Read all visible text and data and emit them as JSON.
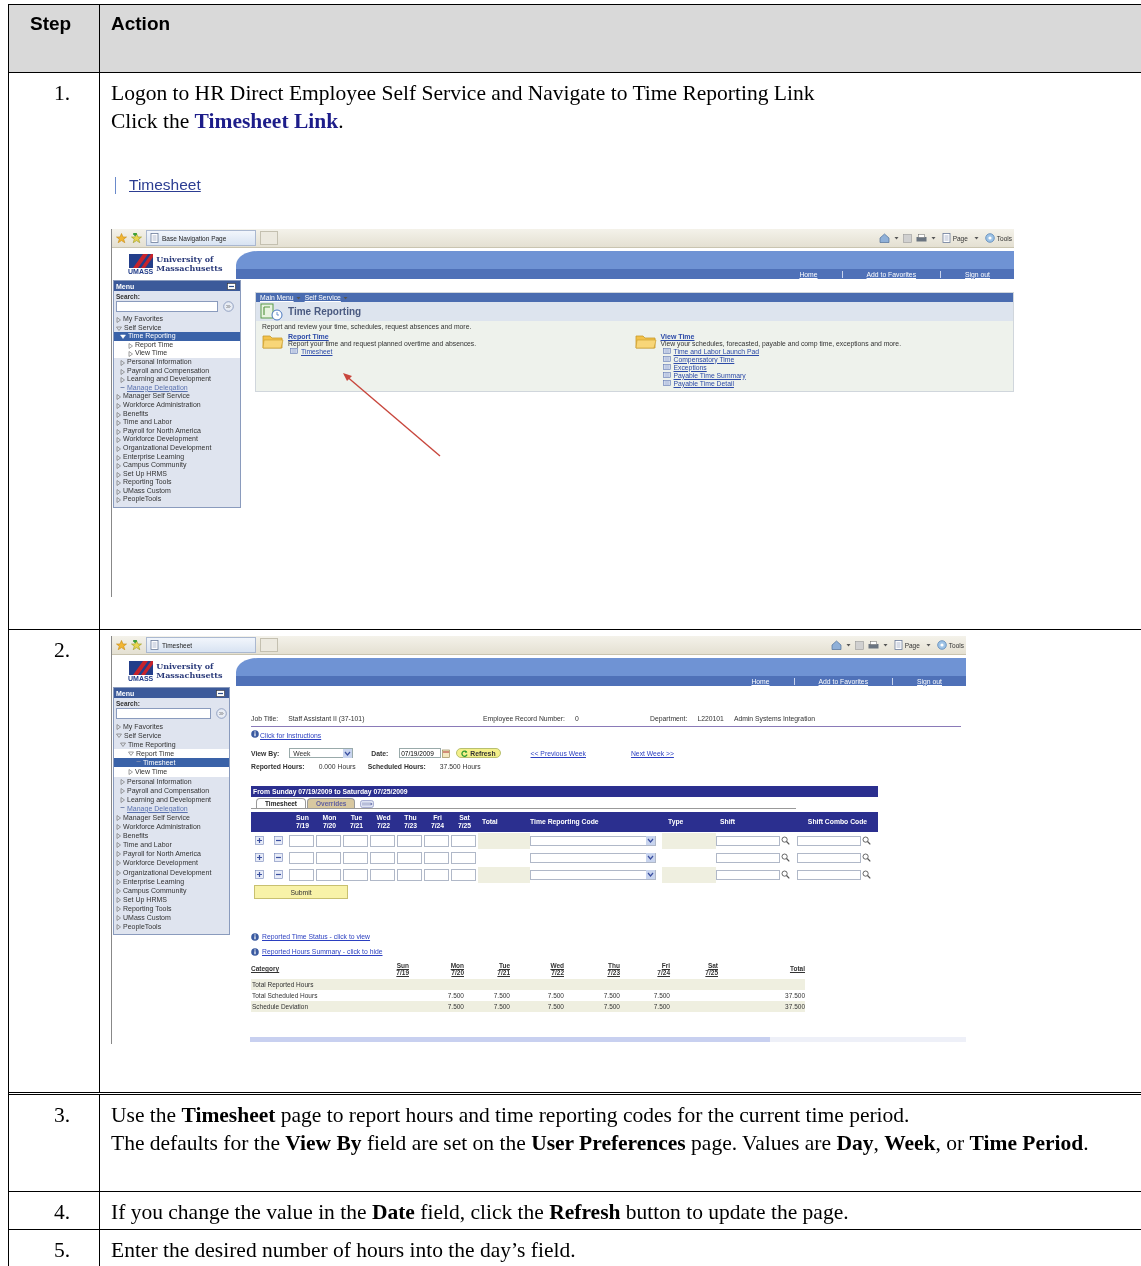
{
  "table": {
    "columns": [
      "Step",
      "Action"
    ],
    "rows": [
      {
        "step": "1.",
        "blocks": [
          {
            "kind": "instruction",
            "lines": [
              "Logon to HR Direct Employee Self Service and Navigate to Time Reporting Link",
              "Click the **Timesheet Link**."
            ]
          },
          {
            "kind": "link",
            "text": "Timesheet"
          },
          {
            "kind": "screenshot",
            "browser": {
              "tab_title": "Base Navigation Page",
              "toolbar": [
                "Page",
                "Tools"
              ]
            },
            "header": {
              "logo_mark": "UMASS",
              "logo_lines": [
                "University of",
                "Massachusetts"
              ],
              "nav": [
                "Home",
                "Add to Favorites",
                "Sign out"
              ]
            },
            "menu": {
              "title": "Menu",
              "search_label": "Search:",
              "items": [
                {
                  "label": "My Favorites",
                  "kind": "folder",
                  "expanded": false,
                  "selected": false
                },
                {
                  "label": "Self Service",
                  "kind": "folder",
                  "expanded": true,
                  "selected": false,
                  "children": [
                    {
                      "label": "Time Reporting",
                      "kind": "folder",
                      "expanded": true,
                      "selected": true,
                      "children": [
                        {
                          "label": "Report Time",
                          "kind": "folder",
                          "expanded": false,
                          "selected": false
                        },
                        {
                          "label": "View Time",
                          "kind": "folder",
                          "expanded": false,
                          "selected": false
                        }
                      ]
                    },
                    {
                      "label": "Personal Information",
                      "kind": "folder",
                      "expanded": false,
                      "selected": false
                    },
                    {
                      "label": "Payroll and Compensation",
                      "kind": "folder",
                      "expanded": false,
                      "selected": false
                    },
                    {
                      "label": "Learning and Development",
                      "kind": "folder",
                      "expanded": false,
                      "selected": false
                    },
                    {
                      "label": "Manage Delegation",
                      "kind": "link",
                      "selected": false
                    }
                  ]
                },
                {
                  "label": "Manager Self Service",
                  "kind": "folder",
                  "expanded": false,
                  "selected": false
                },
                {
                  "label": "Workforce Administration",
                  "kind": "folder",
                  "expanded": false,
                  "selected": false
                },
                {
                  "label": "Benefits",
                  "kind": "folder",
                  "expanded": false,
                  "selected": false
                },
                {
                  "label": "Time and Labor",
                  "kind": "folder",
                  "expanded": false,
                  "selected": false
                },
                {
                  "label": "Payroll for North America",
                  "kind": "folder",
                  "expanded": false,
                  "selected": false
                },
                {
                  "label": "Workforce Development",
                  "kind": "folder",
                  "expanded": false,
                  "selected": false
                },
                {
                  "label": "Organizational Development",
                  "kind": "folder",
                  "expanded": false,
                  "selected": false
                },
                {
                  "label": "Enterprise Learning",
                  "kind": "folder",
                  "expanded": false,
                  "selected": false
                },
                {
                  "label": "Campus Community",
                  "kind": "folder",
                  "expanded": false,
                  "selected": false
                },
                {
                  "label": "Set Up HRMS",
                  "kind": "folder",
                  "expanded": false,
                  "selected": false
                },
                {
                  "label": "Reporting Tools",
                  "kind": "folder",
                  "expanded": false,
                  "selected": false
                },
                {
                  "label": "UMass Custom",
                  "kind": "folder",
                  "expanded": false,
                  "selected": false
                },
                {
                  "label": "PeopleTools",
                  "kind": "folder",
                  "expanded": false,
                  "selected": false
                }
              ]
            },
            "page": {
              "kind": "navigation",
              "breadcrumb": [
                "Main Menu",
                "Self Service"
              ],
              "title": "Time Reporting",
              "description": "Report and review your time, schedules, request absences and more.",
              "sections": [
                {
                  "title": "Report Time",
                  "description": "Report your time and request planned overtime and absences.",
                  "links": [
                    "Timesheet"
                  ]
                },
                {
                  "title": "View Time",
                  "description": "View your schedules, forecasted, payable and comp time, exceptions and more.",
                  "links": [
                    "Time and Labor Launch Pad",
                    "Compensatory Time",
                    "Exceptions",
                    "Payable Time Summary",
                    "Payable Time Detail"
                  ]
                }
              ]
            }
          }
        ]
      },
      {
        "step": "2.",
        "blocks": [
          {
            "kind": "screenshot",
            "browser": {
              "tab_title": "Timesheet",
              "toolbar": [
                "Page",
                "Tools"
              ]
            },
            "header": {
              "logo_mark": "UMASS",
              "logo_lines": [
                "University of",
                "Massachusetts"
              ],
              "nav": [
                "Home",
                "Add to Favorites",
                "Sign out"
              ]
            },
            "menu": {
              "title": "Menu",
              "search_label": "Search:",
              "items": [
                {
                  "label": "My Favorites",
                  "kind": "folder",
                  "expanded": false,
                  "selected": false
                },
                {
                  "label": "Self Service",
                  "kind": "folder",
                  "expanded": true,
                  "selected": false,
                  "children": [
                    {
                      "label": "Time Reporting",
                      "kind": "folder",
                      "expanded": true,
                      "selected": false,
                      "children": [
                        {
                          "label": "Report Time",
                          "kind": "folder",
                          "expanded": true,
                          "selected": false,
                          "children": [
                            {
                              "label": "Timesheet",
                              "kind": "link",
                              "selected": true
                            }
                          ]
                        },
                        {
                          "label": "View Time",
                          "kind": "folder",
                          "expanded": false,
                          "selected": false
                        }
                      ]
                    },
                    {
                      "label": "Personal Information",
                      "kind": "folder",
                      "expanded": false,
                      "selected": false
                    },
                    {
                      "label": "Payroll and Compensation",
                      "kind": "folder",
                      "expanded": false,
                      "selected": false
                    },
                    {
                      "label": "Learning and Development",
                      "kind": "folder",
                      "expanded": false,
                      "selected": false
                    },
                    {
                      "label": "Manage Delegation",
                      "kind": "link",
                      "selected": false
                    }
                  ]
                },
                {
                  "label": "Manager Self Service",
                  "kind": "folder",
                  "expanded": false,
                  "selected": false
                },
                {
                  "label": "Workforce Administration",
                  "kind": "folder",
                  "expanded": false,
                  "selected": false
                },
                {
                  "label": "Benefits",
                  "kind": "folder",
                  "expanded": false,
                  "selected": false
                },
                {
                  "label": "Time and Labor",
                  "kind": "folder",
                  "expanded": false,
                  "selected": false
                },
                {
                  "label": "Payroll for North America",
                  "kind": "folder",
                  "expanded": false,
                  "selected": false
                },
                {
                  "label": "Workforce Development",
                  "kind": "folder",
                  "expanded": false,
                  "selected": false
                },
                {
                  "label": "Organizational Development",
                  "kind": "folder",
                  "expanded": false,
                  "selected": false
                },
                {
                  "label": "Enterprise Learning",
                  "kind": "folder",
                  "expanded": false,
                  "selected": false
                },
                {
                  "label": "Campus Community",
                  "kind": "folder",
                  "expanded": false,
                  "selected": false
                },
                {
                  "label": "Set Up HRMS",
                  "kind": "folder",
                  "expanded": false,
                  "selected": false
                },
                {
                  "label": "Reporting Tools",
                  "kind": "folder",
                  "expanded": false,
                  "selected": false
                },
                {
                  "label": "UMass Custom",
                  "kind": "folder",
                  "expanded": false,
                  "selected": false
                },
                {
                  "label": "PeopleTools",
                  "kind": "folder",
                  "expanded": false,
                  "selected": false
                }
              ]
            },
            "page": {
              "kind": "timesheet",
              "job": [
                {
                  "label": "Job Title:",
                  "values": [
                    "Staff Assistant II (37-101)"
                  ]
                },
                {
                  "label": "Employee Record Number:",
                  "values": [
                    "0"
                  ]
                },
                {
                  "label": "Department:",
                  "values": [
                    "L220101",
                    "Admin Systems Integration"
                  ]
                }
              ],
              "instructions_link": "Click for Instructions",
              "view_by": {
                "label": "View By:",
                "value": "Week"
              },
              "date": {
                "label": "Date:",
                "value": "07/19/2009"
              },
              "refresh_button": "Refresh",
              "previous_link": "<< Previous Week",
              "next_link": "Next Week >>",
              "hours": [
                {
                  "label": "Reported Hours:",
                  "value": "0.000 Hours"
                },
                {
                  "label": "Scheduled Hours:",
                  "value": "37.500 Hours"
                }
              ],
              "grid": {
                "title": "From Sunday 07/19/2009 to Saturday 07/25/2009",
                "tabs": [
                  {
                    "label": "Timesheet",
                    "selected": true
                  },
                  {
                    "label": "Overrides",
                    "selected": false
                  }
                ],
                "days": [
                  {
                    "day": "Sun",
                    "date": "7/19"
                  },
                  {
                    "day": "Mon",
                    "date": "7/20"
                  },
                  {
                    "day": "Tue",
                    "date": "7/21"
                  },
                  {
                    "day": "Wed",
                    "date": "7/22"
                  },
                  {
                    "day": "Thu",
                    "date": "7/23"
                  },
                  {
                    "day": "Fri",
                    "date": "7/24"
                  },
                  {
                    "day": "Sat",
                    "date": "7/25"
                  }
                ],
                "columns": [
                  "Total",
                  "Time Reporting Code",
                  "Type",
                  "Shift",
                  "Shift Combo Code"
                ],
                "rows": [
                  {
                    "shaded": true
                  },
                  {
                    "shaded": false
                  },
                  {
                    "shaded": true
                  }
                ]
              },
              "submit_button": "Submit",
              "links": [
                "Reported Time Status - click to view",
                "Reported Hours Summary - click to hide"
              ],
              "summary": {
                "category_header": "Category",
                "columns": [
                  {
                    "day": "Sun",
                    "date": "7/19"
                  },
                  {
                    "day": "Mon",
                    "date": "7/20",
                    "scheduled": "7.500",
                    "deviation": "7.500"
                  },
                  {
                    "day": "Tue",
                    "date": "7/21",
                    "scheduled": "7.500",
                    "deviation": "7.500"
                  },
                  {
                    "day": "Wed",
                    "date": "7/22",
                    "scheduled": "7.500",
                    "deviation": "7.500"
                  },
                  {
                    "day": "Thu",
                    "date": "7/23",
                    "scheduled": "7.500",
                    "deviation": "7.500"
                  },
                  {
                    "day": "Fri",
                    "date": "7/24",
                    "scheduled": "7.500",
                    "deviation": "7.500"
                  },
                  {
                    "day": "Sat",
                    "date": "7/25"
                  }
                ],
                "total": {
                  "label": "Total",
                  "scheduled": "37.500",
                  "deviation": "37.500"
                },
                "rows": [
                  {
                    "kind": "reported",
                    "category": "Total Reported Hours"
                  },
                  {
                    "kind": "scheduled",
                    "category": "Total Scheduled Hours"
                  },
                  {
                    "kind": "deviation",
                    "category": "Schedule Deviation"
                  }
                ]
              }
            }
          }
        ]
      },
      {
        "step": "3.",
        "blocks": [
          {
            "kind": "text",
            "lines": [
              "Use the **Timesheet** page to report hours and time reporting codes for the current time period.",
              "The defaults for the **View By** field are set on the **User Preferences** page. Values are **Day**, **Week**, or **Time Period**."
            ]
          }
        ]
      },
      {
        "step": "4.",
        "blocks": [
          {
            "kind": "text",
            "lines": [
              "If you change the value in the **Date** field, click the **Refresh** button to update the page."
            ]
          }
        ]
      },
      {
        "step": "5.",
        "blocks": [
          {
            "kind": "text",
            "lines": [
              "Enter the desired number of hours into the day’s field."
            ]
          }
        ]
      }
    ]
  }
}
